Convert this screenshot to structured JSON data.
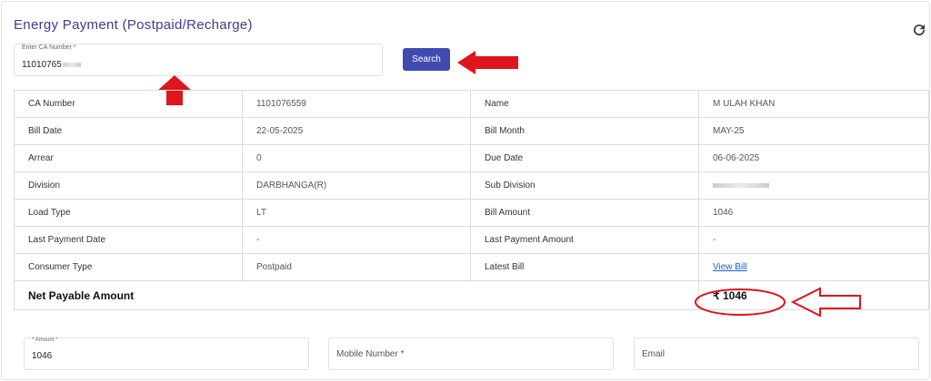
{
  "page": {
    "title": "Energy Payment (Postpaid/Recharge)"
  },
  "search": {
    "ca_label": "Enter CA Number *",
    "ca_value": "11010765",
    "button_label": "Search"
  },
  "table": {
    "rows": [
      {
        "label1": "CA Number",
        "value1": "1101076559",
        "label2": "Name",
        "value2": "M   ULAH KHAN"
      },
      {
        "label1": "Bill Date",
        "value1": "22-05-2025",
        "label2": "Bill Month",
        "value2": "MAY-25"
      },
      {
        "label1": "Arrear",
        "value1": "0",
        "label2": "Due Date",
        "value2": "06-06-2025"
      },
      {
        "label1": "Division",
        "value1": "DARBHANGA(R)",
        "label2": "Sub Division",
        "value2": ""
      },
      {
        "label1": "Load Type",
        "value1": "LT",
        "label2": "Bill Amount",
        "value2": "1046"
      },
      {
        "label1": "Last Payment Date",
        "value1": "-",
        "label2": "Last Payment Amount",
        "value2": "-"
      },
      {
        "label1": "Consumer Type",
        "value1": "Postpaid",
        "label2": "Latest Bill",
        "value2": "View Bill"
      }
    ],
    "net_label": "Net Payable Amount",
    "net_value": "₹ 1046"
  },
  "form": {
    "amount_label": "* Amount *",
    "amount_value": "1046",
    "mobile_placeholder": "Mobile Number *",
    "email_placeholder": "Email"
  },
  "colors": {
    "title": "#3f3b8f",
    "button": "#3f4bb0",
    "arrow": "#e0141c",
    "link": "#1a62c7"
  },
  "icons": {
    "refresh": "refresh-icon"
  }
}
